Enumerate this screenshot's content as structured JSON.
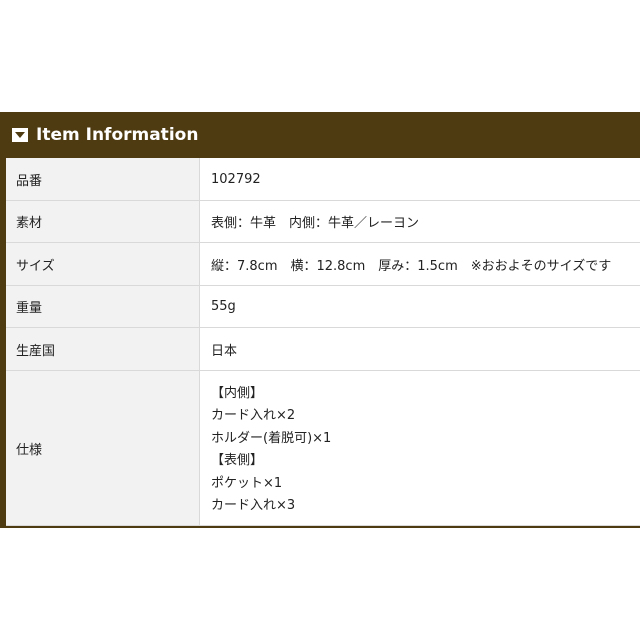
{
  "header": {
    "title": "Item Information",
    "icon": "triangle-down-icon",
    "background_color": "#4f3b12"
  },
  "table": {
    "rows": [
      {
        "label": "品番",
        "value": "102792"
      },
      {
        "label": "素材",
        "value": "表側：牛革　内側：牛革／レーヨン"
      },
      {
        "label": "サイズ",
        "value": "縦：7.8cm　横：12.8cm　厚み：1.5cm　※おおよそのサイズです"
      },
      {
        "label": "重量",
        "value": "55g"
      },
      {
        "label": "生産国",
        "value": "日本"
      },
      {
        "label": "仕様",
        "lines": [
          "【内側】",
          "カード入れ×2",
          "ホルダー(着脱可)×1",
          "【表側】",
          "ポケット×1",
          "カード入れ×3"
        ]
      }
    ]
  }
}
